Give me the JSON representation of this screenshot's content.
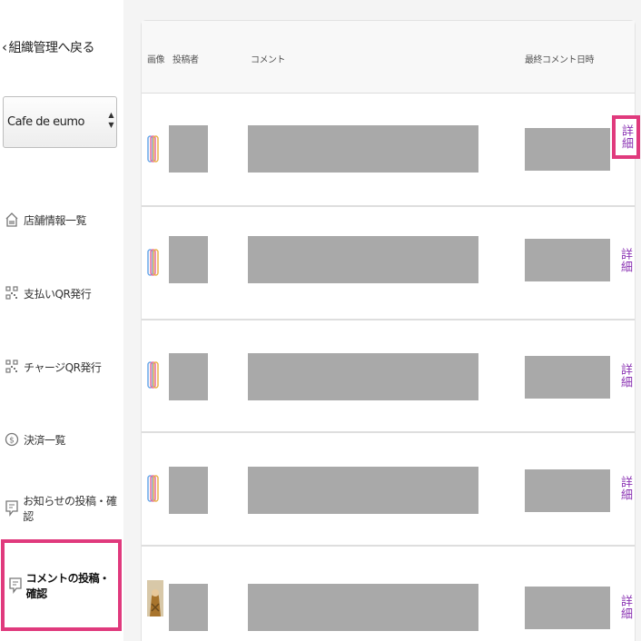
{
  "sidebar": {
    "back_label": "組織管理へ戻る",
    "store_select": {
      "value": "Cafe de eumo"
    },
    "items": [
      {
        "label": "店舗情報一覧",
        "icon": "store-icon",
        "active": false
      },
      {
        "label": "支払いQR発行",
        "icon": "qr-code-icon",
        "active": false
      },
      {
        "label": "チャージQR発行",
        "icon": "qr-code-icon",
        "active": false
      },
      {
        "label": "決済一覧",
        "icon": "dollar-circle-icon",
        "active": false
      },
      {
        "label": "お知らせの投稿・確認",
        "icon": "comment-icon",
        "active": false
      },
      {
        "label": "コメントの投稿・確認",
        "icon": "comment-icon",
        "active": true
      }
    ]
  },
  "table": {
    "headers": {
      "image": "画像",
      "poster": "投稿者",
      "comment": "コメント",
      "last_comment": "最終コメント日時"
    },
    "rows": [
      {
        "thumb": "rainbow-rings",
        "detail_label": "詳細",
        "highlighted": true
      },
      {
        "thumb": "rainbow-rings",
        "detail_label": "詳細",
        "highlighted": false
      },
      {
        "thumb": "rainbow-rings",
        "detail_label": "詳細",
        "highlighted": false
      },
      {
        "thumb": "rainbow-rings",
        "detail_label": "詳細",
        "highlighted": false
      },
      {
        "thumb": "photo",
        "detail_label": "詳細",
        "highlighted": false
      }
    ]
  },
  "colors": {
    "accent": "#e03a7d",
    "link": "#8b33b3",
    "redacted": "#a9a9a9"
  }
}
